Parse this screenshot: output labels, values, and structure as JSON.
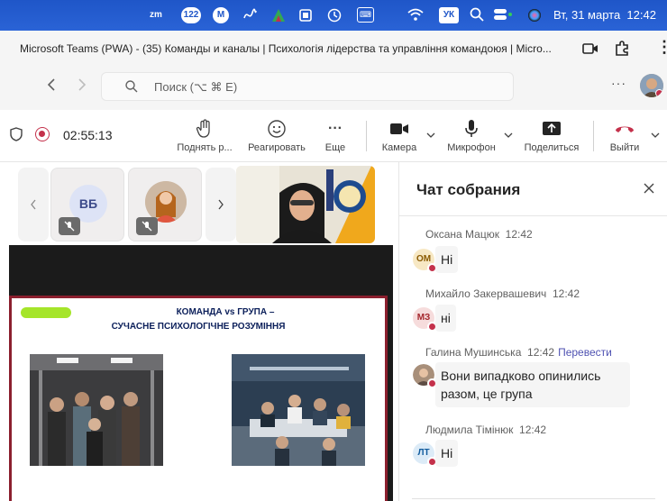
{
  "menubar": {
    "badge_count": "122",
    "clock": "Вт, 31 марта  12:42",
    "icons": [
      "zoom-icon",
      "notification-badge-icon",
      "messenger-icon",
      "scribble-icon",
      "nvidia-icon",
      "pantone-icon",
      "history-icon",
      "keyboard-icon",
      "wifi-icon",
      "input-source-icon",
      "search-icon",
      "control-center-icon",
      "siri-icon"
    ],
    "zoom_label": "zm",
    "input_source": "УК"
  },
  "window": {
    "title": "Microsoft Teams (PWA) - (35) Команды и каналы | Психологія лідерства та управління командоюя | Micro..."
  },
  "search": {
    "placeholder": "Поиск (⌥ ⌘ E)"
  },
  "meeting": {
    "timer": "02:55:13",
    "buttons": {
      "raise_hand": "Поднять р...",
      "react": "Реагировать",
      "more": "Еще",
      "camera": "Камера",
      "mic": "Микрофон",
      "share": "Поделиться",
      "leave": "Выйти"
    }
  },
  "participants": [
    {
      "initials": "ВБ",
      "muted": true
    },
    {
      "initials": "",
      "muted": true
    }
  ],
  "slide": {
    "title_line1": "КОМАНДА vs ГРУПА –",
    "title_line2": "СУЧАСНЕ ПСИХОЛОГІЧНЕ РОЗУМІННЯ"
  },
  "chat": {
    "title": "Чат собрания",
    "messages": [
      {
        "author": "Оксана Мацюк",
        "time": "12:42",
        "initials": "ОМ",
        "text": "Ні",
        "translate": ""
      },
      {
        "author": "Михайло Закервашевич",
        "time": "12:42",
        "initials": "МЗ",
        "text": "ні",
        "translate": ""
      },
      {
        "author": "Галина Мушинська",
        "time": "12:42",
        "initials": "",
        "text_line1": "Вони випадково опинились",
        "text_line2": "разом, це група",
        "translate": "Перевести"
      },
      {
        "author": "Людмила Тімінюк",
        "time": "12:42",
        "initials": "ЛТ",
        "text": "Ні",
        "translate": ""
      }
    ]
  },
  "colors": {
    "menubar": "#1f56c8",
    "accent": "#4f52b2",
    "record": "#c4314b",
    "leave": "#c4314b",
    "slide_border": "#8b1f2e"
  }
}
